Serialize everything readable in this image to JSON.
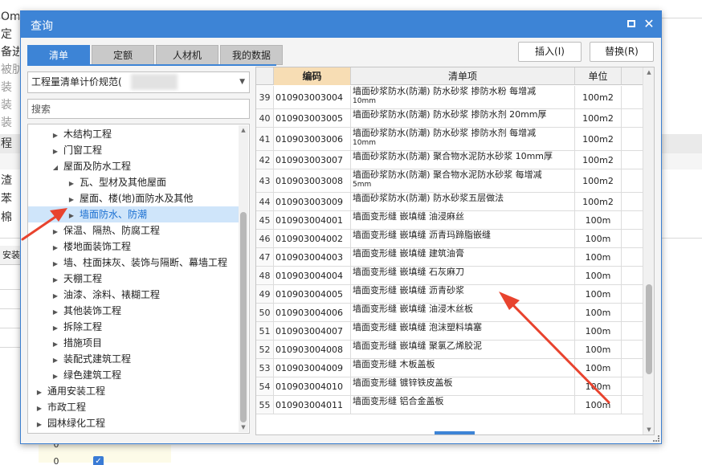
{
  "background": {
    "row_fragments": [
      "Om(6",
      "定",
      "备进",
      "被肪",
      "装",
      "装",
      "装",
      "程",
      "渣",
      "苯",
      "棉",
      "安装"
    ],
    "numbers": [
      "0",
      "0"
    ]
  },
  "dialog": {
    "title": "查询",
    "tabs": [
      {
        "label": "清单",
        "active": true
      },
      {
        "label": "定额",
        "active": false
      },
      {
        "label": "人材机",
        "active": false
      },
      {
        "label": "我的数据",
        "active": false
      }
    ],
    "buttons": {
      "insert": "插入(I)",
      "replace": "替换(R)"
    },
    "spec_select": "工程量清单计价规范(",
    "search_placeholder": "搜索",
    "tree": [
      {
        "label": "木结构工程",
        "level": 1,
        "expanded": false
      },
      {
        "label": "门窗工程",
        "level": 1,
        "expanded": false
      },
      {
        "label": "屋面及防水工程",
        "level": 1,
        "expanded": true
      },
      {
        "label": "瓦、型材及其他屋面",
        "level": 2,
        "expanded": false
      },
      {
        "label": "屋面、楼(地)面防水及其他",
        "level": 2,
        "expanded": false
      },
      {
        "label": "墙面防水、防潮",
        "level": 2,
        "expanded": false,
        "selected": true
      },
      {
        "label": "保温、隔热、防腐工程",
        "level": 1,
        "expanded": false
      },
      {
        "label": "楼地面装饰工程",
        "level": 1,
        "expanded": false
      },
      {
        "label": "墙、柱面抹灰、装饰与隔断、幕墙工程",
        "level": 1,
        "expanded": false
      },
      {
        "label": "天棚工程",
        "level": 1,
        "expanded": false
      },
      {
        "label": "油漆、涂料、裱糊工程",
        "level": 1,
        "expanded": false
      },
      {
        "label": "其他装饰工程",
        "level": 1,
        "expanded": false
      },
      {
        "label": "拆除工程",
        "level": 1,
        "expanded": false
      },
      {
        "label": "措施项目",
        "level": 1,
        "expanded": false
      },
      {
        "label": "装配式建筑工程",
        "level": 1,
        "expanded": false
      },
      {
        "label": "绿色建筑工程",
        "level": 1,
        "expanded": false
      },
      {
        "label": "通用安装工程",
        "level": 0,
        "expanded": false
      },
      {
        "label": "市政工程",
        "level": 0,
        "expanded": false
      },
      {
        "label": "园林绿化工程",
        "level": 0,
        "expanded": false
      }
    ],
    "grid": {
      "headers": {
        "code": "编码",
        "item": "清单项",
        "unit": "单位"
      },
      "rows": [
        {
          "num": "39",
          "code": "010903003004",
          "item": "墙面砂浆防水(防潮) 防水砂浆 掺防水粉 每增减",
          "item2": "10mm",
          "unit": "100m2"
        },
        {
          "num": "40",
          "code": "010903003005",
          "item": "墙面砂浆防水(防潮) 防水砂浆 掺防水剂 20mm厚",
          "item2": "",
          "unit": "100m2"
        },
        {
          "num": "41",
          "code": "010903003006",
          "item": "墙面砂浆防水(防潮) 防水砂浆 掺防水剂 每增减",
          "item2": "10mm",
          "unit": "100m2"
        },
        {
          "num": "42",
          "code": "010903003007",
          "item": "墙面砂浆防水(防潮) 聚合物水泥防水砂浆 10mm厚",
          "item2": "",
          "unit": "100m2"
        },
        {
          "num": "43",
          "code": "010903003008",
          "item": "墙面砂浆防水(防潮) 聚合物水泥防水砂浆 每增减",
          "item2": "5mm",
          "unit": "100m2"
        },
        {
          "num": "44",
          "code": "010903003009",
          "item": "墙面砂浆防水(防潮) 防水砂浆五层做法",
          "item2": "",
          "unit": "100m2"
        },
        {
          "num": "45",
          "code": "010903004001",
          "item": "墙面变形缝 嵌填缝 油浸麻丝",
          "item2": "",
          "unit": "100m"
        },
        {
          "num": "46",
          "code": "010903004002",
          "item": "墙面变形缝 嵌填缝 沥青玛蹄脂嵌缝",
          "item2": "",
          "unit": "100m"
        },
        {
          "num": "47",
          "code": "010903004003",
          "item": "墙面变形缝 嵌填缝 建筑油膏",
          "item2": "",
          "unit": "100m"
        },
        {
          "num": "48",
          "code": "010903004004",
          "item": "墙面变形缝 嵌填缝 石灰麻刀",
          "item2": "",
          "unit": "100m"
        },
        {
          "num": "49",
          "code": "010903004005",
          "item": "墙面变形缝 嵌填缝 沥青砂浆",
          "item2": "",
          "unit": "100m"
        },
        {
          "num": "50",
          "code": "010903004006",
          "item": "墙面变形缝 嵌填缝 油浸木丝板",
          "item2": "",
          "unit": "100m"
        },
        {
          "num": "51",
          "code": "010903004007",
          "item": "墙面变形缝 嵌填缝 泡沫塑料填塞",
          "item2": "",
          "unit": "100m"
        },
        {
          "num": "52",
          "code": "010903004008",
          "item": "墙面变形缝 嵌填缝 聚氯乙烯胶泥",
          "item2": "",
          "unit": "100m"
        },
        {
          "num": "53",
          "code": "010903004009",
          "item": "墙面变形缝 木板盖板",
          "item2": "",
          "unit": "100m"
        },
        {
          "num": "54",
          "code": "010903004010",
          "item": "墙面变形缝 镀锌铁皮盖板",
          "item2": "",
          "unit": "100m"
        },
        {
          "num": "55",
          "code": "010903004011",
          "item": "墙面变形缝 铝合金盖板",
          "item2": "",
          "unit": "100m"
        }
      ]
    }
  },
  "colors": {
    "accent": "#3d84d6",
    "annotation": "#e8432e",
    "selected_row": "#cfe5fa",
    "header_highlight": "#f7ddb4"
  }
}
